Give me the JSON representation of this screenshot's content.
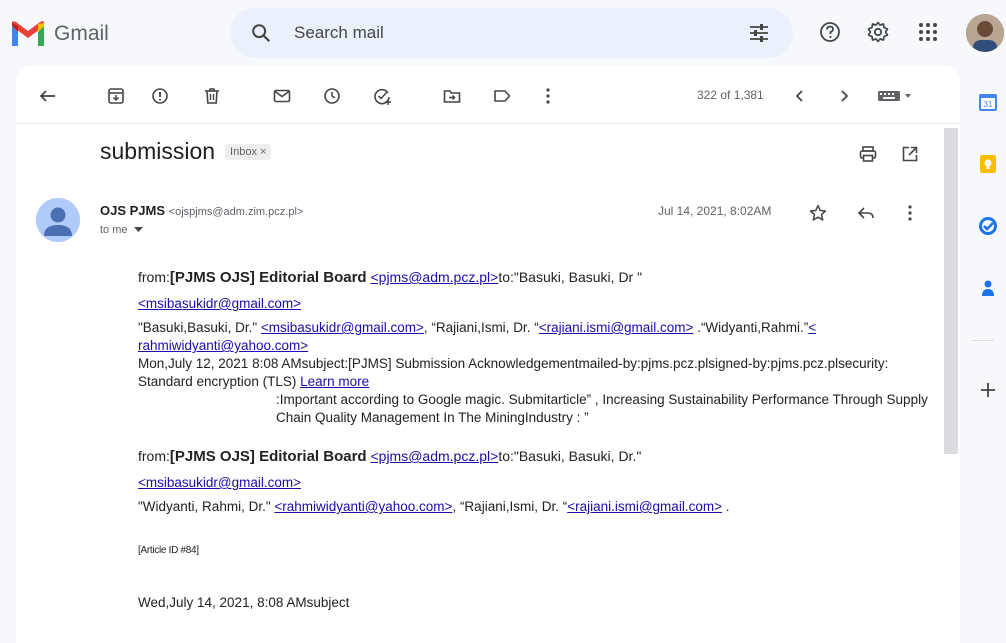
{
  "app": {
    "name": "Gmail",
    "search_placeholder": "Search mail",
    "accent_red": "#ea4335",
    "accent_blue": "#4285f4"
  },
  "toolbar": {
    "pager": "322 of 1,381"
  },
  "email": {
    "subject": "submission",
    "label_chip": "Inbox ×",
    "sender_name": "OJS PJMS",
    "sender_email": "<ojspjms@adm.zim.pcz.pl>",
    "to_me": "to me",
    "date": "Jul 14, 2021, 8:02AM"
  },
  "body": {
    "b1_from": "from:",
    "b1_board": "[PJMS OJS] Editorial Board",
    "b1_board_email": "<pjms@adm.pcz.pl>",
    "b1_to": "to:\"Basuki, Basuki, Dr \"",
    "b1_to_email": "<msibasukidr@gmail.com>",
    "b1_cc1": "\"Basuki,Basuki, Dr.\"",
    "b1_cc1_email": "<msibasukidr@gmail.com>",
    "b1_cc2": ", “Rajiani,Ismi, Dr. “",
    "b1_cc2_email": "<rajiani.ismi@gmail.com>",
    "b1_cc3": " .“Widyanti,Rahmi.”",
    "b1_cc3_email": "< rahmiwidyanti@yahoo.com>",
    "b1_line_a": "Mon,July 12, 2021  8:08 AMsubject:[PJMS] Submission Acknowledgementmailed-by:pjms.pcz.plsigned-by:pjms.pcz.plsecurity: Standard encryption (TLS)",
    "b1_learn_more": "Learn more",
    "b1_line_b": ":Important according to Google magic. Submitarticle” , Increasing Sustainability Performance Through Supply Chain Quality Management In The MiningIndustry  :    ”",
    "b2_from": "from:",
    "b2_board": "[PJMS OJS] Editorial Board",
    "b2_board_email": "<pjms@adm.pcz.pl>",
    "b2_to": "to:\"Basuki, Basuki, Dr.\"",
    "b2_to_email": "<msibasukidr@gmail.com>",
    "b2_cc1": "\"Widyanti, Rahmi, Dr.\"",
    "b2_cc1_email": "<rahmiwidyanti@yahoo.com>",
    "b2_cc2": ", “Rajiani,Ismi, Dr. “",
    "b2_cc2_email": "<rajiani.ismi@gmail.com>",
    "b2_cc2_end": " .",
    "article_id": "[Article ID #84]",
    "last_line": "Wed,July 14, 2021, 8:08 AMsubject"
  },
  "rightbar": {
    "calendar_day": "31"
  }
}
